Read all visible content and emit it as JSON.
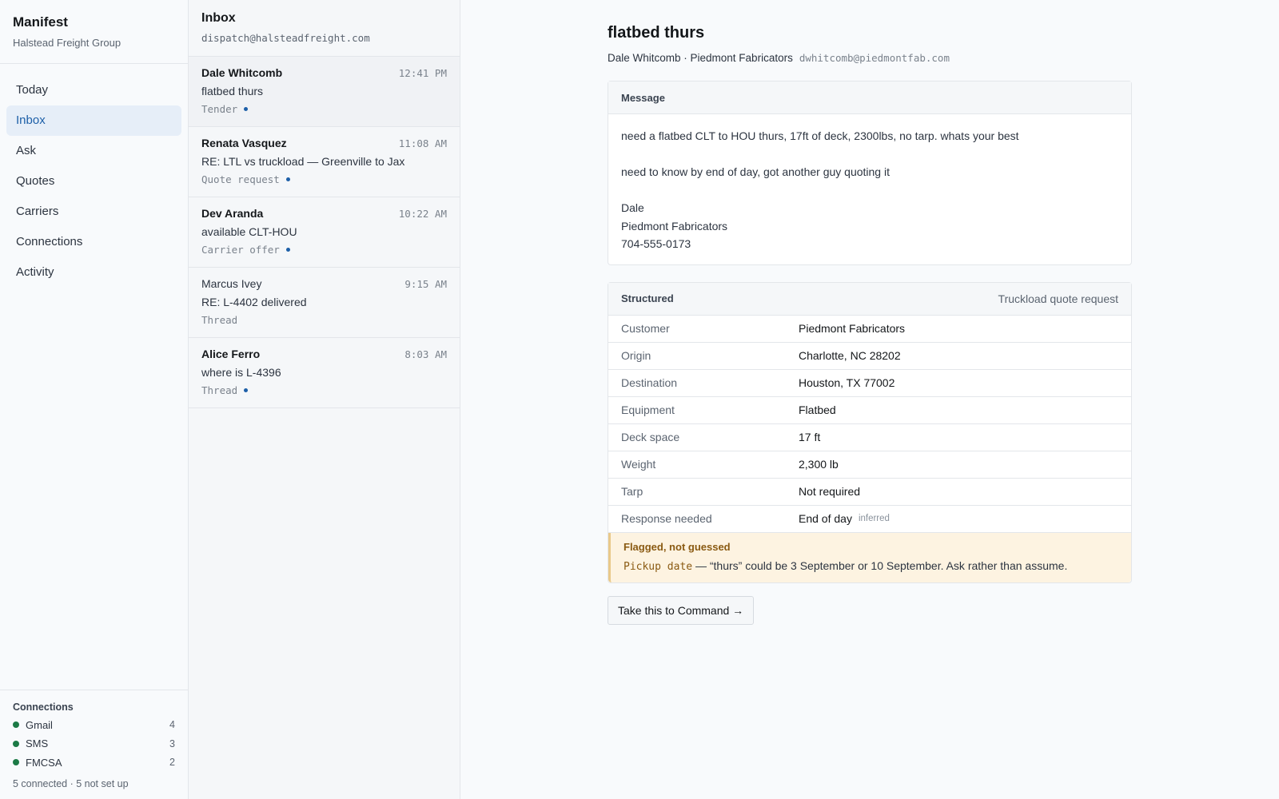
{
  "brand": {
    "name": "Manifest",
    "org": "Halstead Freight Group"
  },
  "nav": [
    {
      "label": "Today",
      "active": false
    },
    {
      "label": "Inbox",
      "active": true
    },
    {
      "label": "Ask",
      "active": false
    },
    {
      "label": "Quotes",
      "active": false
    },
    {
      "label": "Carriers",
      "active": false
    },
    {
      "label": "Connections",
      "active": false
    },
    {
      "label": "Activity",
      "active": false
    }
  ],
  "connections": {
    "title": "Connections",
    "items": [
      {
        "name": "Gmail",
        "count": "4"
      },
      {
        "name": "SMS",
        "count": "3"
      },
      {
        "name": "FMCSA",
        "count": "2"
      }
    ],
    "summary": "5 connected · 5 not set up",
    "status_color": "#1c7a46"
  },
  "inbox": {
    "title": "Inbox",
    "address": "dispatch@halsteadfreight.com",
    "messages": [
      {
        "sender": "Dale Whitcomb",
        "time": "12:41 PM",
        "subject": "flatbed thurs",
        "tag": "Tender",
        "unread": true
      },
      {
        "sender": "Renata Vasquez",
        "time": "11:08 AM",
        "subject": "RE: LTL vs truckload — Greenville to Jax",
        "tag": "Quote request",
        "unread": true
      },
      {
        "sender": "Dev Aranda",
        "time": "10:22 AM",
        "subject": "available CLT-HOU",
        "tag": "Carrier offer",
        "unread": true
      },
      {
        "sender": "Marcus Ivey",
        "time": "9:15 AM",
        "subject": "RE: L-4402 delivered",
        "tag": "Thread",
        "unread": false
      },
      {
        "sender": "Alice Ferro",
        "time": "8:03 AM",
        "subject": "where is L-4396",
        "tag": "Thread",
        "unread": true
      }
    ]
  },
  "detail": {
    "subject": "flatbed thurs",
    "from": "Dale Whitcomb · Piedmont Fabricators",
    "email": "dwhitcomb@piedmontfab.com",
    "message": {
      "heading": "Message",
      "line1": "need a flatbed CLT to HOU thurs, 17ft of deck, 2300lbs, no tarp. whats your best",
      "line2": "need to know by end of day, got another guy quoting it",
      "sig_name": "Dale",
      "sig_company": "Piedmont Fabricators",
      "sig_phone": "704-555-0173"
    },
    "structured": {
      "heading": "Structured",
      "type": "Truckload quote request",
      "fields": [
        {
          "label": "Customer",
          "value": "Piedmont Fabricators"
        },
        {
          "label": "Origin",
          "value": "Charlotte, NC 28202"
        },
        {
          "label": "Destination",
          "value": "Houston, TX 77002"
        },
        {
          "label": "Equipment",
          "value": "Flatbed"
        },
        {
          "label": "Deck space",
          "value": "17 ft"
        },
        {
          "label": "Weight",
          "value": "2,300 lb"
        },
        {
          "label": "Tarp",
          "value": "Not required"
        },
        {
          "label": "Response needed",
          "value": "End of day",
          "note": "inferred"
        }
      ],
      "flag": {
        "title": "Flagged, not guessed",
        "field": "Pickup date",
        "text": " — “thurs” could be 3 September or 10 September. Ask rather than assume."
      }
    },
    "command_button": "Take this to Command →"
  },
  "colors": {
    "accent": "#1d5fa8",
    "flag_bg": "#fdf3e1"
  }
}
